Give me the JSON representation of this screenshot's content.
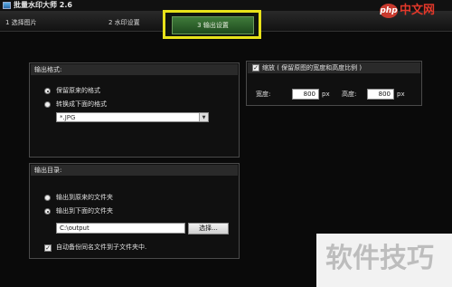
{
  "window": {
    "title": "批量水印大师 2.6"
  },
  "tabs": [
    {
      "label": "1  选择图片"
    },
    {
      "label": "2  水印设置"
    },
    {
      "label": "3  输出设置"
    }
  ],
  "output_format": {
    "title": "输出格式:",
    "option_keep": "保留原来的格式",
    "option_convert": "转换成下面的格式",
    "format_value": "*.JPG"
  },
  "output_dir": {
    "title": "输出目录:",
    "option_original": "输出到原来的文件夹",
    "option_below": "输出到下面的文件夹",
    "path_value": "C:\\output",
    "browse_label": "选择...",
    "backup_label": "自动备份同名文件到子文件夹中."
  },
  "resize": {
    "title": "缩放 ( 保留原图的宽度和高度比例 )",
    "width_label": "宽度:",
    "width_value": "800",
    "width_unit": "px",
    "height_label": "高度:",
    "height_value": "800",
    "height_unit": "px"
  },
  "watermarks": {
    "php_logo": "php",
    "php_cn": "中文网",
    "big": "软件技巧"
  },
  "colors": {
    "highlight": "#e8e21a",
    "active_tab": "#2e6a2a",
    "brand_red": "#c83a2e"
  }
}
